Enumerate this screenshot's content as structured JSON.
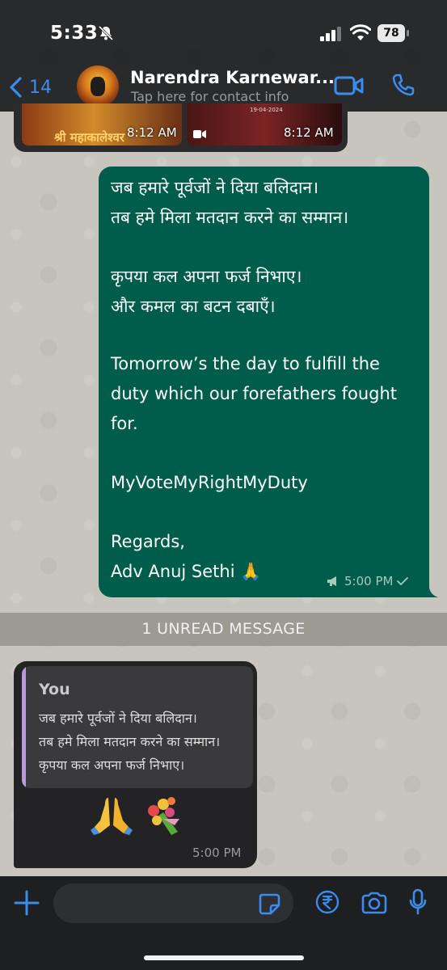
{
  "status_bar": {
    "time": "5:33",
    "battery": "78"
  },
  "header": {
    "back_count": "14",
    "contact_name": "Narendra Karnewar...",
    "contact_subtitle": "Tap here for contact info"
  },
  "media_message": {
    "thumb1_text": "श्री महाकालेश्वर",
    "thumb2_text": "19-04-2024",
    "time1": "8:12 AM",
    "time2": "8:12 AM"
  },
  "outgoing_message": {
    "lines": [
      "जब हमारे पूर्वजों ने दिया बलिदान।",
      "तब हमे मिला मतदान करने का सम्मान।",
      "",
      "कृपया कल अपना फर्ज निभाए।",
      "और कमल का बटन दबाएँ।",
      "",
      "Tomorrow’s the day to fulfill the",
      "duty which our forefathers fought",
      "for.",
      "",
      "MyVoteMyRightMyDuty",
      "",
      "Regards,",
      "Adv Anuj Sethi 🙏"
    ],
    "time": "5:00 PM"
  },
  "unread_banner": "1 UNREAD MESSAGE",
  "incoming_message": {
    "quote_author": "You",
    "quote_lines": [
      "जब हमारे पूर्वजों ने दिया बलिदान।",
      "तब हमे मिला मतदान करने का सम्मान।",
      "कृपया कल अपना फर्ज निभाए।"
    ],
    "emojis": "🙏 💐",
    "time": "5:00 PM"
  },
  "colors": {
    "accent": "#3b8cf0",
    "outgoing_bubble": "#005c4b",
    "incoming_bubble": "#232325"
  }
}
